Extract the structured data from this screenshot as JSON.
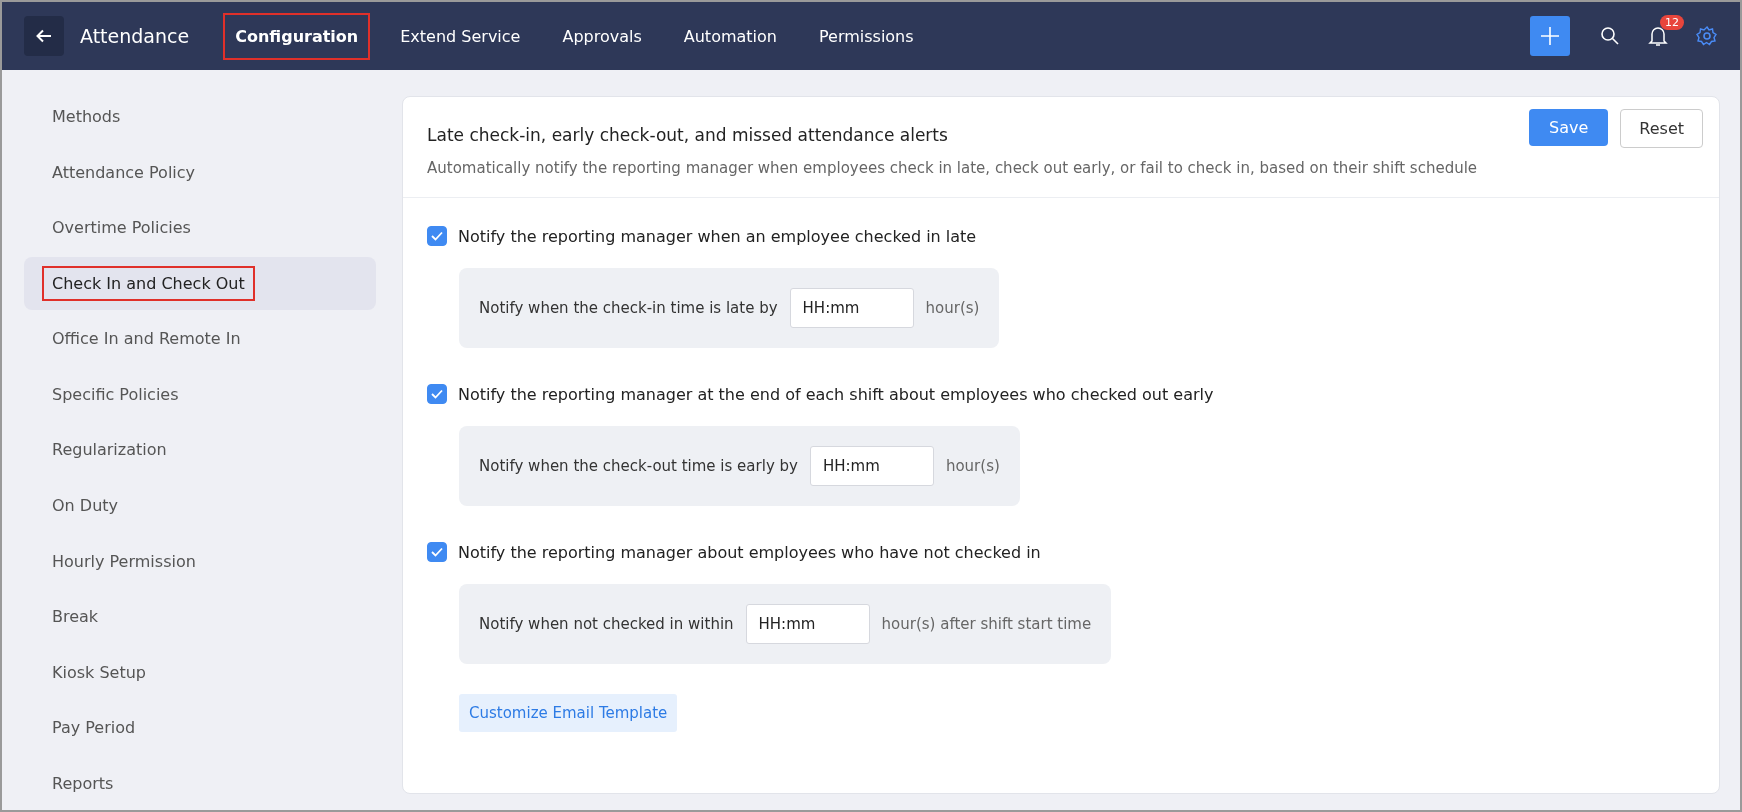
{
  "topbar": {
    "title": "Attendance",
    "tabs": [
      {
        "label": "Configuration",
        "selected": true,
        "highlighted": true
      },
      {
        "label": "Extend Service",
        "selected": false,
        "highlighted": false
      },
      {
        "label": "Approvals",
        "selected": false,
        "highlighted": false
      },
      {
        "label": "Automation",
        "selected": false,
        "highlighted": false
      },
      {
        "label": "Permissions",
        "selected": false,
        "highlighted": false
      }
    ],
    "notification_count": "12"
  },
  "sidebar": {
    "items": [
      {
        "label": "Methods",
        "selected": false,
        "highlighted": false
      },
      {
        "label": "Attendance Policy",
        "selected": false,
        "highlighted": false
      },
      {
        "label": "Overtime Policies",
        "selected": false,
        "highlighted": false
      },
      {
        "label": "Check In and Check Out",
        "selected": true,
        "highlighted": true
      },
      {
        "label": "Office In and Remote In",
        "selected": false,
        "highlighted": false
      },
      {
        "label": "Specific Policies",
        "selected": false,
        "highlighted": false
      },
      {
        "label": "Regularization",
        "selected": false,
        "highlighted": false
      },
      {
        "label": "On Duty",
        "selected": false,
        "highlighted": false
      },
      {
        "label": "Hourly Permission",
        "selected": false,
        "highlighted": false
      },
      {
        "label": "Break",
        "selected": false,
        "highlighted": false
      },
      {
        "label": "Kiosk Setup",
        "selected": false,
        "highlighted": false
      },
      {
        "label": "Pay Period",
        "selected": false,
        "highlighted": false
      },
      {
        "label": "Reports",
        "selected": false,
        "highlighted": false
      }
    ]
  },
  "panel": {
    "title": "Late check-in, early check-out, and missed attendance alerts",
    "description": "Automatically notify the reporting manager when employees check in late, check out early, or fail to check in, based on their shift schedule",
    "buttons": [
      "Save",
      "Reset"
    ],
    "options": [
      {
        "label": "Notify the reporting manager when an employee checked in late",
        "checked": true,
        "prompt": "Notify when the check-in time is late by",
        "value": "HH:mm",
        "unit": "hour(s)"
      },
      {
        "label": "Notify the reporting manager at the end of each shift about employees who checked out early",
        "checked": true,
        "prompt": "Notify when the check-out time is early by",
        "value": "HH:mm",
        "unit": "hour(s)"
      },
      {
        "label": "Notify the reporting manager about employees who have not checked in",
        "checked": true,
        "prompt": "Notify when not checked in within",
        "value": "HH:mm",
        "unit": "hour(s) after shift start time"
      }
    ],
    "link": "Customize Email Template"
  }
}
